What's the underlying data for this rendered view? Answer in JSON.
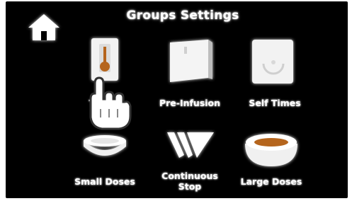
{
  "header": {
    "title": "Groups Settings"
  },
  "icons": {
    "home": "home-icon",
    "pointer": "hand-pointer-icon"
  },
  "tiles": [
    {
      "label": "Temps",
      "icon": "thermostat-icon"
    },
    {
      "label": "Pre-Infusion",
      "icon": "pre-infusion-panel-icon"
    },
    {
      "label": "Self Times",
      "icon": "clock-panel-icon"
    },
    {
      "label": "Small Doses",
      "icon": "small-cup-icon"
    },
    {
      "label": "Continuous\nStop",
      "icon": "continuous-stop-icon"
    },
    {
      "label": "Large Doses",
      "icon": "large-cup-icon"
    }
  ],
  "colors": {
    "background": "#000000",
    "icon": "#ffffff",
    "accent": "#b5651d"
  }
}
